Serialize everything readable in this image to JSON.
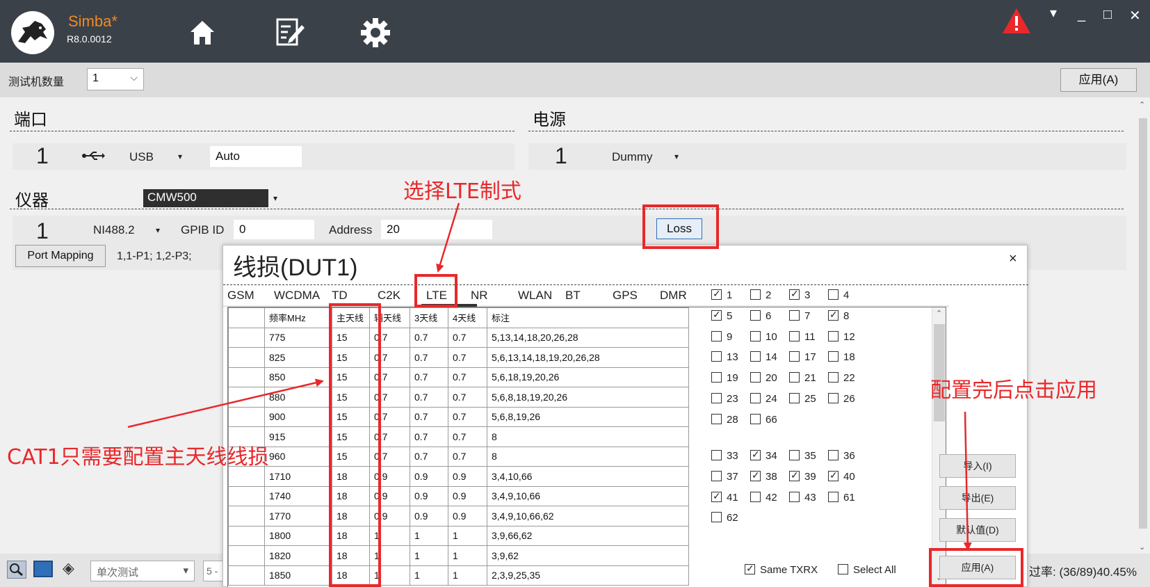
{
  "app": {
    "name": "Simba*",
    "version": "R8.0.0012"
  },
  "toolbar": {
    "home_icon": "home-icon",
    "edit_icon": "edit-icon",
    "settings_icon": "gear-icon"
  },
  "window": {
    "alert_icon": "warning-icon",
    "menu_glyph": "▾",
    "minimize_glyph": "_",
    "maximize_glyph": "□",
    "close_glyph": "✕"
  },
  "tester": {
    "label": "测试机数量",
    "count": "1",
    "apply_label": "应用(A)"
  },
  "port": {
    "section_title": "端口",
    "index": "1",
    "type": "USB",
    "mode": "Auto"
  },
  "power": {
    "section_title": "电源",
    "index": "1",
    "type": "Dummy"
  },
  "instrument": {
    "section_title": "仪器",
    "model": "CMW500",
    "index": "1",
    "interface": "NI488.2",
    "gpib_label": "GPIB ID",
    "gpib_value": "0",
    "address_label": "Address",
    "address_value": "20",
    "loss_label": "Loss",
    "port_mapping_label": "Port Mapping",
    "port_mapping_value": "1,1-P1; 1,2-P3;"
  },
  "status": {
    "mode": "单次测试",
    "field": "5 -",
    "pass_rate": "过率: (36/89)40.45%"
  },
  "dialog": {
    "title": "线损(DUT1)",
    "close_glyph": "×",
    "tabs": [
      "GSM",
      "WCDMA",
      "TD",
      "C2K",
      "LTE",
      "NR",
      "WLAN",
      "BT",
      "GPS",
      "DMR"
    ],
    "active_tab": "LTE",
    "columns": [
      "",
      "频率MHz",
      "主天线",
      "辅天线",
      "3天线",
      "4天线",
      "标注"
    ],
    "rows": [
      [
        "",
        "775",
        "15",
        "0.7",
        "0.7",
        "0.7",
        "5,13,14,18,20,26,28"
      ],
      [
        "",
        "825",
        "15",
        "0.7",
        "0.7",
        "0.7",
        "5,6,13,14,18,19,20,26,28"
      ],
      [
        "",
        "850",
        "15",
        "0.7",
        "0.7",
        "0.7",
        "5,6,18,19,20,26"
      ],
      [
        "",
        "880",
        "15",
        "0.7",
        "0.7",
        "0.7",
        "5,6,8,18,19,20,26"
      ],
      [
        "",
        "900",
        "15",
        "0.7",
        "0.7",
        "0.7",
        "5,6,8,19,26"
      ],
      [
        "",
        "915",
        "15",
        "0.7",
        "0.7",
        "0.7",
        "8"
      ],
      [
        "",
        "960",
        "15",
        "0.7",
        "0.7",
        "0.7",
        "8"
      ],
      [
        "",
        "1710",
        "18",
        "0.9",
        "0.9",
        "0.9",
        "3,4,10,66"
      ],
      [
        "",
        "1740",
        "18",
        "0.9",
        "0.9",
        "0.9",
        "3,4,9,10,66"
      ],
      [
        "",
        "1770",
        "18",
        "0.9",
        "0.9",
        "0.9",
        "3,4,9,10,66,62"
      ],
      [
        "",
        "1800",
        "18",
        "1",
        "1",
        "1",
        "3,9,66,62"
      ],
      [
        "",
        "1820",
        "18",
        "1",
        "1",
        "1",
        "3,9,62"
      ],
      [
        "",
        "1850",
        "18",
        "1",
        "1",
        "1",
        "2,3,9,25,35"
      ]
    ],
    "bands_group1": [
      {
        "label": "1",
        "checked": true
      },
      {
        "label": "2",
        "checked": false
      },
      {
        "label": "3",
        "checked": true
      },
      {
        "label": "4",
        "checked": false
      },
      {
        "label": "5",
        "checked": true
      },
      {
        "label": "6",
        "checked": false
      },
      {
        "label": "7",
        "checked": false
      },
      {
        "label": "8",
        "checked": true
      },
      {
        "label": "9",
        "checked": false
      },
      {
        "label": "10",
        "checked": false
      },
      {
        "label": "11",
        "checked": false
      },
      {
        "label": "12",
        "checked": false
      },
      {
        "label": "13",
        "checked": false
      },
      {
        "label": "14",
        "checked": false
      },
      {
        "label": "17",
        "checked": false
      },
      {
        "label": "18",
        "checked": false
      },
      {
        "label": "19",
        "checked": false
      },
      {
        "label": "20",
        "checked": false
      },
      {
        "label": "21",
        "checked": false
      },
      {
        "label": "22",
        "checked": false
      },
      {
        "label": "23",
        "checked": false
      },
      {
        "label": "24",
        "checked": false
      },
      {
        "label": "25",
        "checked": false
      },
      {
        "label": "26",
        "checked": false
      },
      {
        "label": "28",
        "checked": false
      },
      {
        "label": "66",
        "checked": false
      }
    ],
    "bands_group2": [
      {
        "label": "33",
        "checked": false
      },
      {
        "label": "34",
        "checked": true
      },
      {
        "label": "35",
        "checked": false
      },
      {
        "label": "36",
        "checked": false
      },
      {
        "label": "37",
        "checked": false
      },
      {
        "label": "38",
        "checked": true
      },
      {
        "label": "39",
        "checked": true
      },
      {
        "label": "40",
        "checked": true
      },
      {
        "label": "41",
        "checked": true
      },
      {
        "label": "42",
        "checked": false
      },
      {
        "label": "43",
        "checked": false
      },
      {
        "label": "61",
        "checked": false
      },
      {
        "label": "62",
        "checked": false
      }
    ],
    "same_txrx": {
      "label": "Same TXRX",
      "checked": true
    },
    "select_all": {
      "label": "Select All",
      "checked": false
    },
    "buttons": {
      "import": "导入(I)",
      "export": "导出(E)",
      "default": "默认值(D)",
      "apply": "应用(A)"
    }
  },
  "annotations": {
    "select_lte": "选择LTE制式",
    "cat1_note": "CAT1只需要配置主天线线损",
    "apply_note": "配置完后点击应用",
    "color": "#e8282b"
  }
}
